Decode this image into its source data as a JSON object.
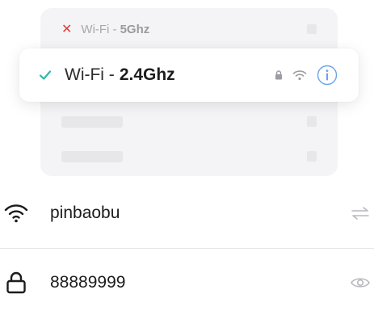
{
  "networks": {
    "other": {
      "prefix": "Wi-Fi - ",
      "band": "5Ghz",
      "status_icon": "x-icon"
    },
    "selected": {
      "prefix": "Wi-Fi - ",
      "band": "2.4Ghz",
      "status_icon": "check-icon"
    }
  },
  "form": {
    "ssid": {
      "icon": "wifi-icon",
      "value": "pinbaobu",
      "action_icon": "swap-icon"
    },
    "password": {
      "icon": "lock-icon",
      "value": "88889999",
      "action_icon": "eye-icon"
    }
  },
  "colors": {
    "accent_check": "#2fb7a6",
    "error_x": "#e03a3a",
    "info_blue": "#6aa4e8",
    "card_bg": "#f4f4f6"
  }
}
